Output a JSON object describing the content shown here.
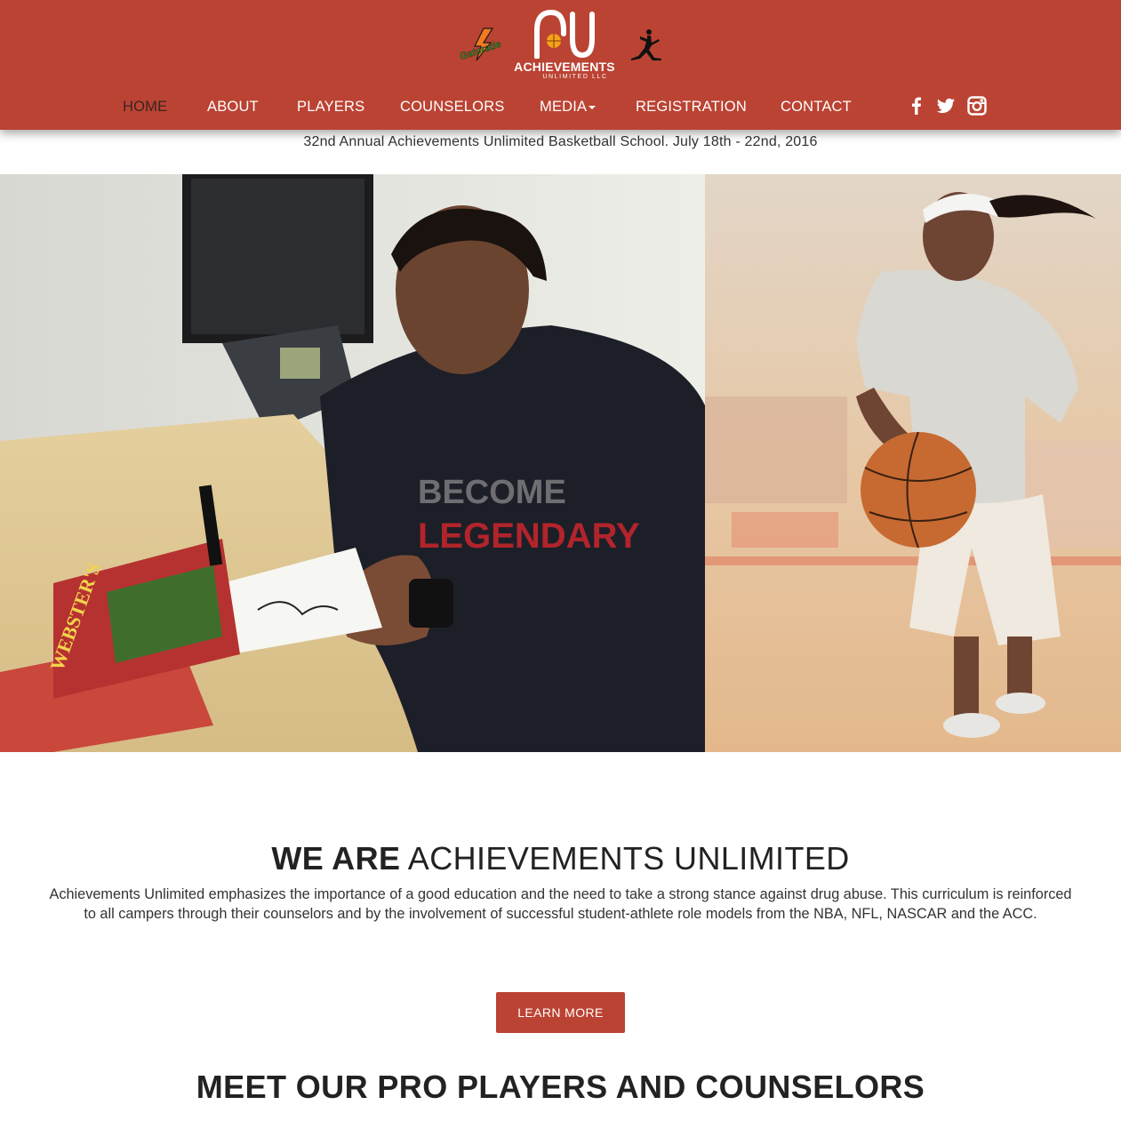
{
  "header": {
    "logo_text": "ACHIEVEMENTS",
    "logo_subtext": "UNLIMITED LLC",
    "sponsor_left": "Gatorade",
    "colors": {
      "header_bg": "#bb4333",
      "active_nav": "#3a2420",
      "button_bg": "#bb4333"
    }
  },
  "nav": {
    "items": [
      {
        "label": "HOME",
        "active": true
      },
      {
        "label": "ABOUT",
        "active": false
      },
      {
        "label": "PLAYERS",
        "active": false
      },
      {
        "label": "COUNSELORS",
        "active": false
      },
      {
        "label": "MEDIA",
        "active": false,
        "dropdown": true
      },
      {
        "label": "REGISTRATION",
        "active": false
      },
      {
        "label": "CONTACT",
        "active": false
      }
    ],
    "social": [
      "facebook-icon",
      "twitter-icon",
      "instagram-icon"
    ]
  },
  "announcement": "32nd Annual Achievements Unlimited Basketball School. July 18th - 22nd, 2016",
  "about": {
    "title_strong": "WE ARE",
    "title_rest": " ACHIEVEMENTS UNLIMITED",
    "text": "Achievements Unlimited emphasizes the importance of a good education and the need to take a strong stance against drug abuse. This curriculum is reinforced to all campers through their counselors and by the involvement of successful student-athlete role models from the NBA, NFL, NASCAR and the ACC.",
    "button_label": "LEARN MORE"
  },
  "players_section": {
    "title": "MEET OUR PRO PLAYERS AND COUNSELORS"
  }
}
